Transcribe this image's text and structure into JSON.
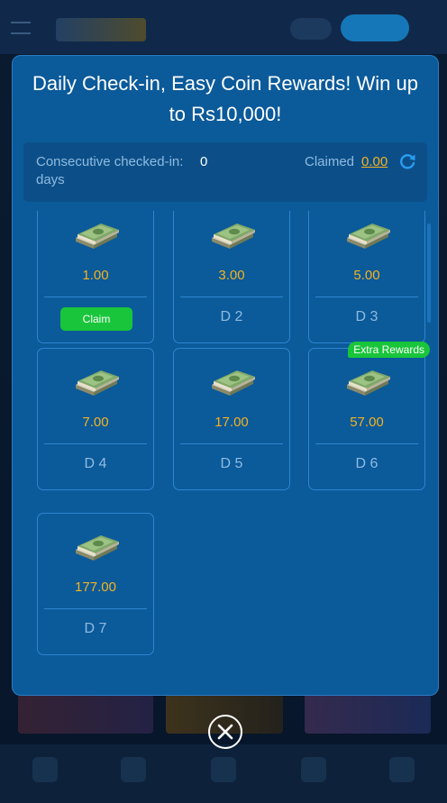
{
  "modal": {
    "title": "Daily Check-in, Easy Coin Rewards! Win up to Rs10,000!",
    "consecutive_label": "Consecutive checked-in:",
    "consecutive_count": "0",
    "consecutive_unit": "days",
    "claimed_label": "Claimed",
    "claimed_amount": "0.00",
    "refresh_icon": "refresh-icon",
    "close_icon": "close-icon"
  },
  "rewards": [
    {
      "amount": "1.00",
      "action": "Claim"
    },
    {
      "amount": "3.00",
      "day": "D 2"
    },
    {
      "amount": "5.00",
      "day": "D 3"
    },
    {
      "amount": "7.00",
      "day": "D 4"
    },
    {
      "amount": "17.00",
      "day": "D 5"
    },
    {
      "amount": "57.00",
      "day": "D 6",
      "badge": "Extra Rewards"
    },
    {
      "amount": "177.00",
      "day": "D 7"
    }
  ],
  "colors": {
    "modal_bg": "#0b5a9a",
    "accent_gold": "#f5b21f",
    "claim_green": "#19c53a",
    "muted_text": "#8fbbe0"
  }
}
